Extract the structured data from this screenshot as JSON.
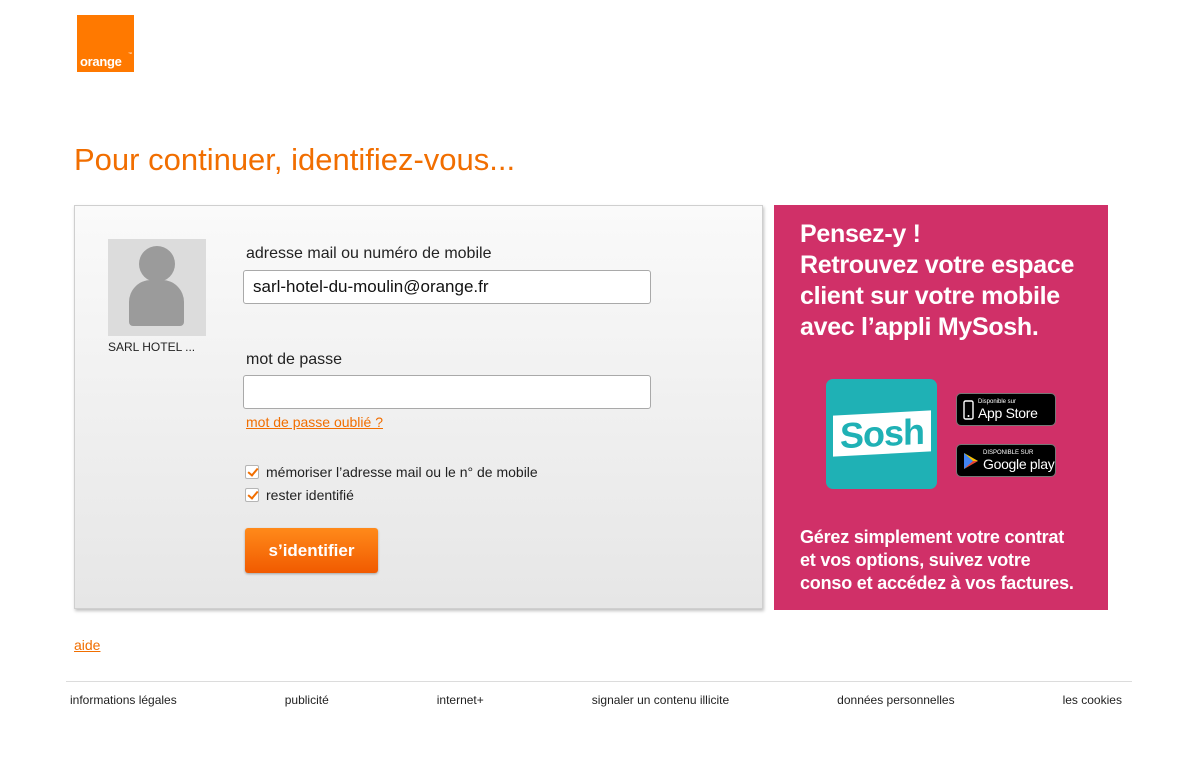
{
  "logo": {
    "text": "orange",
    "tm": "™"
  },
  "page_title": "Pour continuer, identifiez-vous...",
  "account": {
    "name": "SARL HOTEL ..."
  },
  "form": {
    "email_label": "adresse mail ou numéro de mobile",
    "email_value": "sarl-hotel-du-moulin@orange.fr",
    "password_label": "mot de passe",
    "password_value": "",
    "forgot_password": "mot de passe oublié ?",
    "remember_label": "mémoriser l’adresse mail ou le n° de mobile",
    "remember_checked": true,
    "stay_logged_label": "rester identifié",
    "stay_logged_checked": true,
    "submit_label": "s’identifier"
  },
  "promo": {
    "title_lines": [
      "Pensez-y !",
      "Retrouvez votre espace",
      "client sur votre mobile",
      "avec l’appli MySosh."
    ],
    "app_name": "Sosh",
    "app_store": {
      "small": "Disponible sur",
      "big": "App Store"
    },
    "google_play": {
      "small": "DISPONIBLE SUR",
      "big": "Google play"
    },
    "desc_lines": [
      "Gérez simplement votre contrat",
      "et vos options, suivez votre",
      "conso et accédez à vos factures."
    ],
    "background_color": "#d03068",
    "tile_color": "#1fb1b5"
  },
  "help_link": "aide",
  "footer": {
    "links": [
      "informations légales",
      "publicité",
      "internet+",
      "signaler un contenu illicite",
      "données personnelles",
      "les cookies"
    ]
  },
  "colors": {
    "brand": "#ff7900",
    "link": "#f16e00"
  }
}
